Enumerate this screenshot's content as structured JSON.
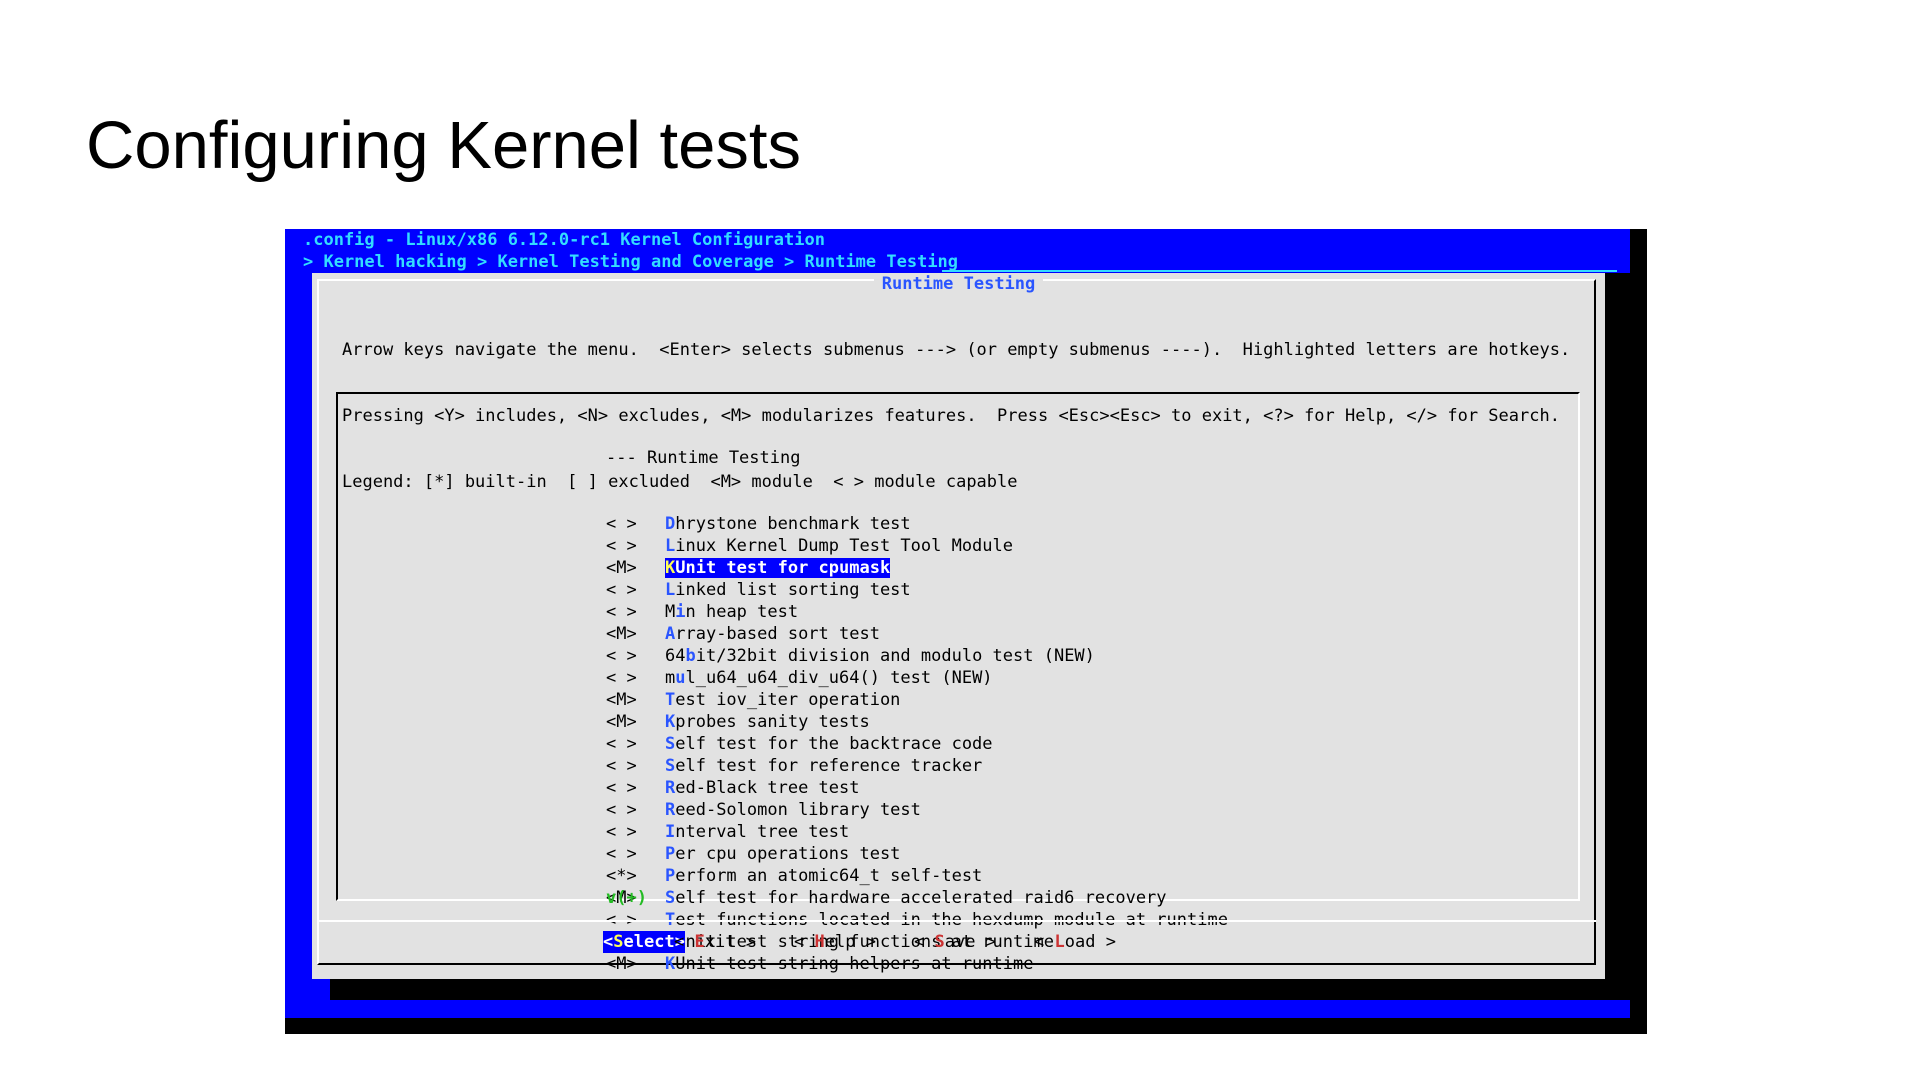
{
  "slide": {
    "title": "Configuring Kernel tests"
  },
  "header": {
    "title": ".config - Linux/x86 6.12.0-rc1 Kernel Configuration",
    "breadcrumb": "> Kernel hacking > Kernel Testing and Coverage > Runtime Testing"
  },
  "dialog": {
    "title": "Runtime Testing",
    "help_lines": [
      "Arrow keys navigate the menu.  <Enter> selects submenus ---> (or empty submenus ----).  Highlighted letters are hotkeys.",
      "Pressing <Y> includes, <N> excludes, <M> modularizes features.  Press <Esc><Esc> to exit, <?> for Help, </> for Search.",
      "Legend: [*] built-in  [ ] excluded  <M> module  < > module capable"
    ],
    "menu_heading": "--- Runtime Testing",
    "more_indicator": "v(+)",
    "selected_index": 2,
    "items": [
      {
        "state": "< >",
        "hotkey_prefix": "",
        "hotkey": "D",
        "rest": "hrystone benchmark test"
      },
      {
        "state": "< >",
        "hotkey_prefix": "",
        "hotkey": "L",
        "rest": "inux Kernel Dump Test Tool Module"
      },
      {
        "state": "<M>",
        "hotkey_prefix": "",
        "hotkey": "K",
        "rest": "Unit test for cpumask"
      },
      {
        "state": "< >",
        "hotkey_prefix": "",
        "hotkey": "L",
        "rest": "inked list sorting test"
      },
      {
        "state": "< >",
        "hotkey_prefix": "M",
        "hotkey": "i",
        "rest": "n heap test"
      },
      {
        "state": "<M>",
        "hotkey_prefix": "",
        "hotkey": "A",
        "rest": "rray-based sort test"
      },
      {
        "state": "< >",
        "hotkey_prefix": "64",
        "hotkey": "b",
        "rest": "it/32bit division and modulo test (NEW)"
      },
      {
        "state": "< >",
        "hotkey_prefix": "m",
        "hotkey": "u",
        "rest": "l_u64_u64_div_u64() test (NEW)"
      },
      {
        "state": "<M>",
        "hotkey_prefix": "",
        "hotkey": "T",
        "rest": "est iov_iter operation"
      },
      {
        "state": "<M>",
        "hotkey_prefix": "",
        "hotkey": "K",
        "rest": "probes sanity tests"
      },
      {
        "state": "< >",
        "hotkey_prefix": "",
        "hotkey": "S",
        "rest": "elf test for the backtrace code"
      },
      {
        "state": "< >",
        "hotkey_prefix": "",
        "hotkey": "S",
        "rest": "elf test for reference tracker"
      },
      {
        "state": "< >",
        "hotkey_prefix": "",
        "hotkey": "R",
        "rest": "ed-Black tree test"
      },
      {
        "state": "< >",
        "hotkey_prefix": "",
        "hotkey": "R",
        "rest": "eed-Solomon library test"
      },
      {
        "state": "< >",
        "hotkey_prefix": "",
        "hotkey": "I",
        "rest": "nterval tree test"
      },
      {
        "state": "< >",
        "hotkey_prefix": "",
        "hotkey": "P",
        "rest": "er cpu operations test"
      },
      {
        "state": "<*>",
        "hotkey_prefix": "",
        "hotkey": "P",
        "rest": "erform an atomic64_t self-test"
      },
      {
        "state": "<M>",
        "hotkey_prefix": "",
        "hotkey": "S",
        "rest": "elf test for hardware accelerated raid6 recovery"
      },
      {
        "state": "< >",
        "hotkey_prefix": "",
        "hotkey": "T",
        "rest": "est functions located in the hexdump module at runtime"
      },
      {
        "state": "<M>",
        "hotkey_prefix": "",
        "hotkey": "K",
        "rest": "Unit test string functions at runtime"
      },
      {
        "state": "<M>",
        "hotkey_prefix": "",
        "hotkey": "K",
        "rest": "Unit test string helpers at runtime"
      }
    ],
    "buttons": [
      {
        "id": "select",
        "open": "<",
        "hotkey": "S",
        "rest": "elect",
        "close": ">",
        "active": true
      },
      {
        "id": "exit",
        "open": "< ",
        "hotkey": "E",
        "rest": "xit",
        "close": " >",
        "active": false
      },
      {
        "id": "help",
        "open": "< ",
        "hotkey": "H",
        "rest": "elp",
        "close": " >",
        "active": false
      },
      {
        "id": "save",
        "open": "< ",
        "hotkey": "S",
        "rest": "ave",
        "close": " >",
        "active": false
      },
      {
        "id": "load",
        "open": "< ",
        "hotkey": "L",
        "rest": "oad",
        "close": " >",
        "active": false
      }
    ]
  },
  "colors": {
    "terminal_bg": "#0000ff",
    "dialog_bg": "#e2e2e2",
    "header_text": "#33ddff",
    "hotkey": "#2a55ff",
    "button_hotkey": "#cc3333",
    "more_indicator": "#22bb22"
  }
}
